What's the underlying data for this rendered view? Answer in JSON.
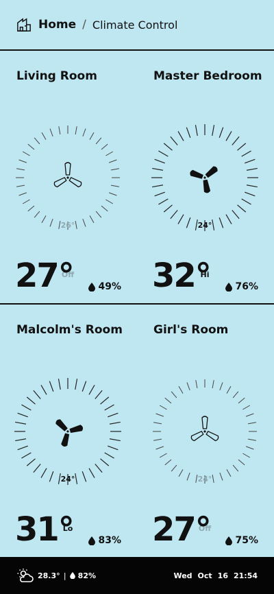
{
  "breadcrumb": {
    "home": "Home",
    "separator": "/",
    "page": "Climate Control",
    "home_icon": "home-icon"
  },
  "rooms": [
    {
      "name": "Living Room",
      "set_temp": "26°",
      "mode": "Off",
      "temp": "27°",
      "humidity": "49%",
      "active": false,
      "fan_angle": 0
    },
    {
      "name": "Master Bedroom",
      "set_temp": "24°",
      "mode": "Hi",
      "temp": "32°",
      "humidity": "76%",
      "active": true,
      "fan_angle": 170
    },
    {
      "name": "Malcolm's Room",
      "set_temp": "24°",
      "mode": "Lo",
      "temp": "31°",
      "humidity": "83%",
      "active": true,
      "fan_angle": 195
    },
    {
      "name": "Girl's Room",
      "set_temp": "24°",
      "mode": "Off",
      "temp": "27°",
      "humidity": "75%",
      "active": false,
      "fan_angle": 0
    }
  ],
  "footer": {
    "weather_icon": "partly-cloudy-icon",
    "outdoor_temp": "28.3°",
    "separator": "|",
    "outdoor_humidity": "82%",
    "day": "Wed",
    "month": "Oct",
    "date": "16",
    "time": "21:54"
  },
  "colors": {
    "background": "#bfe7f1",
    "text": "#111111",
    "inactive": "#8fa9b1",
    "footer": "#050505"
  }
}
